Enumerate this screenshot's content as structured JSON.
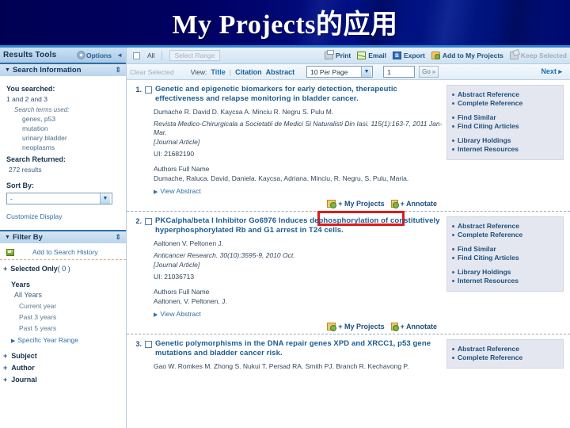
{
  "slide": {
    "title": "My Projects的应用",
    "banner_color_left": "#000053",
    "banner_color_right": "#000a6e",
    "banner_rule_color": "#2f86d0",
    "highlight_color": "#e01b1b"
  },
  "sidebar": {
    "results_tools_label": "Results Tools",
    "options_label": "Options",
    "collapse_arrow": "◄",
    "search_information": {
      "header": "Search Information",
      "you_searched_label": "You searched:",
      "query": "1 and 2 and 3",
      "terms_label": "Search terms used:",
      "terms": [
        "genes, p53",
        "mutation",
        "urinary bladder",
        "neoplasms"
      ],
      "returned_label": "Search Returned:",
      "returned_value": "272 results",
      "sort_by_label": "Sort By:",
      "sort_by_value": "-",
      "customize_display": "Customize Display"
    },
    "filter_by": {
      "header": "Filter By",
      "add_to_search_history": "Add to Search History",
      "selected_only_label": "Selected Only",
      "selected_only_count": "( 0 )",
      "years_label": "Years",
      "all_years": "All Years",
      "year_options": [
        "Current year",
        "Past 3 years",
        "Past 5 years"
      ],
      "specific_year_range": "Specific Year Range",
      "facets": [
        "Subject",
        "Author",
        "Journal"
      ],
      "plus": "+"
    }
  },
  "toolbar": {
    "all_label": "All",
    "select_range_label": "Select Range",
    "actions": [
      {
        "label": "Print",
        "icon": "printer-icon",
        "disabled": false
      },
      {
        "label": "Email",
        "icon": "envelope-icon",
        "disabled": false
      },
      {
        "label": "Export",
        "icon": "export-icon",
        "disabled": false
      },
      {
        "label": "Add to My Projects",
        "icon": "folder-icon",
        "disabled": false
      },
      {
        "label": "Keep Selected",
        "icon": "keep-icon",
        "disabled": true
      }
    ],
    "clear_selected": "Clear Selected",
    "view_label": "View:",
    "view_options": [
      "Title",
      "Citation",
      "Abstract"
    ],
    "per_page_value": "10 Per Page",
    "page_number": "1",
    "go_label": "Go",
    "next_label": "Next"
  },
  "side_links": {
    "groups": [
      [
        "Abstract Reference",
        "Complete Reference"
      ],
      [
        "Find Similar",
        "Find Citing Articles"
      ],
      [
        "Library Holdings",
        "Internet Resources"
      ]
    ]
  },
  "record_actions": {
    "my_projects": "+ My Projects",
    "annotate": "+ Annotate",
    "view_abstract": "View Abstract"
  },
  "records": [
    {
      "num": "1.",
      "title": "Genetic and epigenetic biomarkers for early detection, therapeutic effectiveness and relapse monitoring in bladder cancer.",
      "authors": "Dumache R. David D. Kaycsa A. Minciu R. Negru S. Pulu M.",
      "journal": "Revista Medico-Chirurgicala a Societatii de Medici Si Naturalisti Din Iasi. 115(1):163-7, 2011 Jan-Mar.",
      "pubtype": "[Journal Article]",
      "ui": "UI: 21682190",
      "authors_full_name_label": "Authors Full Name",
      "authors_full_name": "Dumache, Raluca. David, Daniela. Kaycsa, Adriana. Minciu, R. Negru, S. Pulu, Maria."
    },
    {
      "num": "2.",
      "title": "PKCalpha/beta I Inhibitor Go6976 Induces dephosphorylation of constitutively hyperphosphorylated Rb and G1 arrest in T24 cells.",
      "authors": "Aaltonen V. Peltonen J.",
      "journal": "Anticancer Research. 30(10):3595-9, 2010 Oct.",
      "pubtype": "[Journal Article]",
      "ui": "UI: 21036713",
      "authors_full_name_label": "Authors Full Name",
      "authors_full_name": "Aaltonen, V. Peltonen, J."
    },
    {
      "num": "3.",
      "title": "Genetic polymorphisms in the DNA repair genes XPD and XRCC1, p53 gene mutations and bladder cancer risk.",
      "authors": "Gao W. Romkes M. Zhong S. Nukui T. Persad RA. Smith PJ. Branch R. Kechavong P.",
      "journal": "",
      "pubtype": "",
      "ui": "",
      "authors_full_name_label": "",
      "authors_full_name": ""
    }
  ]
}
